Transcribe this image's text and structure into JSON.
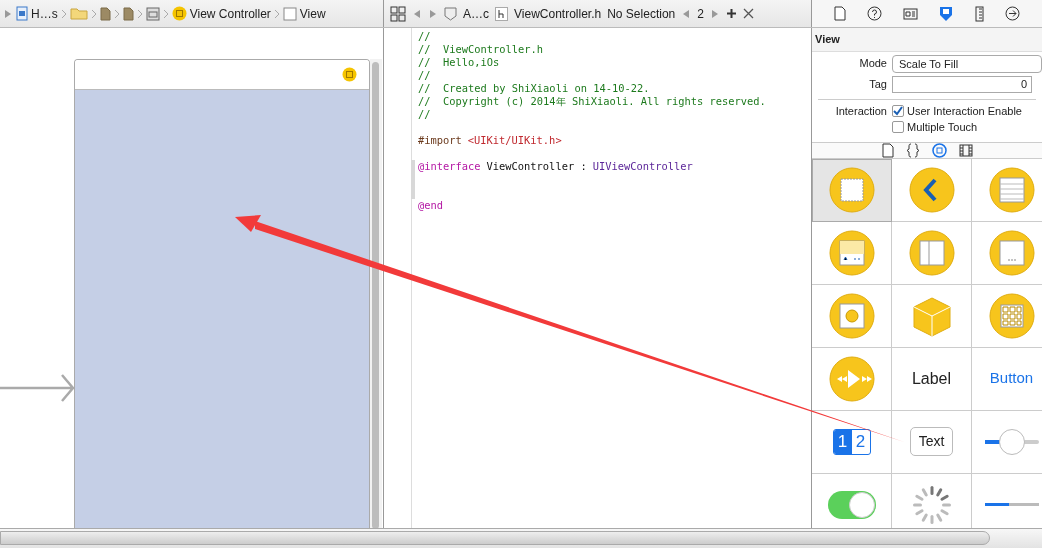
{
  "storyboard_bar": {
    "items": [
      {
        "kind": "project",
        "label": "H…s"
      },
      {
        "kind": "folder"
      },
      {
        "kind": "file"
      },
      {
        "kind": "file"
      },
      {
        "kind": "scene"
      },
      {
        "kind": "controller",
        "label": "View Controller"
      },
      {
        "kind": "view",
        "label": "View"
      }
    ]
  },
  "editor_bar": {
    "items": [
      {
        "kind": "assistant",
        "label": "A…c"
      },
      {
        "kind": "header",
        "label": "ViewController.h"
      },
      {
        "kind": "plain",
        "label": "No Selection"
      }
    ],
    "counter": "2"
  },
  "code_blocks": [
    {
      "marked": false,
      "lines": [
        [
          {
            "kind": "comment",
            "text": "//"
          }
        ],
        [
          {
            "kind": "comment",
            "text": "//  ViewController.h"
          }
        ],
        [
          {
            "kind": "comment",
            "text": "//  Hello,iOs"
          }
        ],
        [
          {
            "kind": "comment",
            "text": "//"
          }
        ],
        [
          {
            "kind": "comment",
            "text": "//  Created by ShiXiaoli on 14-10-22."
          }
        ],
        [
          {
            "kind": "comment",
            "text": "//  Copyright (c) 2014年 ShiXiaoli. All rights reserved."
          }
        ],
        [
          {
            "kind": "comment",
            "text": "//"
          }
        ]
      ]
    },
    {
      "marked": false,
      "lines": [
        [
          {
            "kind": "directive",
            "text": "#import"
          },
          {
            "kind": "string",
            "text": "<UIKit/UIKit.h>"
          }
        ]
      ]
    },
    {
      "marked": true,
      "lines": [
        [
          {
            "kind": "keyword",
            "text": "@interface"
          },
          {
            "kind": "plain",
            "text": "ViewController :"
          },
          {
            "kind": "class",
            "text": "UIViewController"
          }
        ]
      ]
    },
    {
      "marked": false,
      "lines": [
        [
          {
            "kind": "keyword",
            "text": "@end"
          }
        ]
      ]
    }
  ],
  "inspector": {
    "tabs": [
      {
        "kind": "file",
        "selected": false
      },
      {
        "kind": "help",
        "selected": false
      },
      {
        "kind": "identity",
        "selected": false
      },
      {
        "kind": "attributes",
        "selected": true
      },
      {
        "kind": "size",
        "selected": false
      },
      {
        "kind": "connections",
        "selected": false
      }
    ],
    "section": "View",
    "mode_label": "Mode",
    "mode_value": "Scale To Fill",
    "tag_label": "Tag",
    "tag_value": "0",
    "interaction_label": "Interaction",
    "checks": [
      {
        "label": "User Interaction Enable",
        "checked": true
      },
      {
        "label": "Multiple Touch",
        "checked": false
      }
    ]
  },
  "library": {
    "tabs": [
      {
        "kind": "file",
        "selected": false
      },
      {
        "kind": "braces",
        "selected": false
      },
      {
        "kind": "object",
        "selected": true
      },
      {
        "kind": "media",
        "selected": false
      }
    ],
    "items": [
      {
        "kind": "view",
        "selected": true
      },
      {
        "kind": "navigation",
        "selected": false
      },
      {
        "kind": "table",
        "selected": false
      },
      {
        "kind": "tabbar",
        "selected": false
      },
      {
        "kind": "split",
        "selected": false
      },
      {
        "kind": "page",
        "selected": false
      },
      {
        "kind": "camera",
        "selected": false
      },
      {
        "kind": "cube",
        "selected": false
      },
      {
        "kind": "collection",
        "selected": false
      },
      {
        "kind": "media",
        "selected": false
      },
      {
        "kind": "label",
        "text": "Label",
        "selected": false
      },
      {
        "kind": "button",
        "text": "Button",
        "selected": false
      },
      {
        "kind": "segmented",
        "selected": false,
        "segments": [
          {
            "text": "1",
            "selected": true
          },
          {
            "text": "2",
            "selected": false
          }
        ]
      },
      {
        "kind": "textfield",
        "text": "Text",
        "selected": false
      },
      {
        "kind": "slider",
        "level": 0.3,
        "selected": false
      },
      {
        "kind": "switch",
        "on": true,
        "selected": false
      },
      {
        "kind": "spinner",
        "selected": false
      },
      {
        "kind": "progress",
        "level": 0.45,
        "selected": false
      }
    ]
  }
}
